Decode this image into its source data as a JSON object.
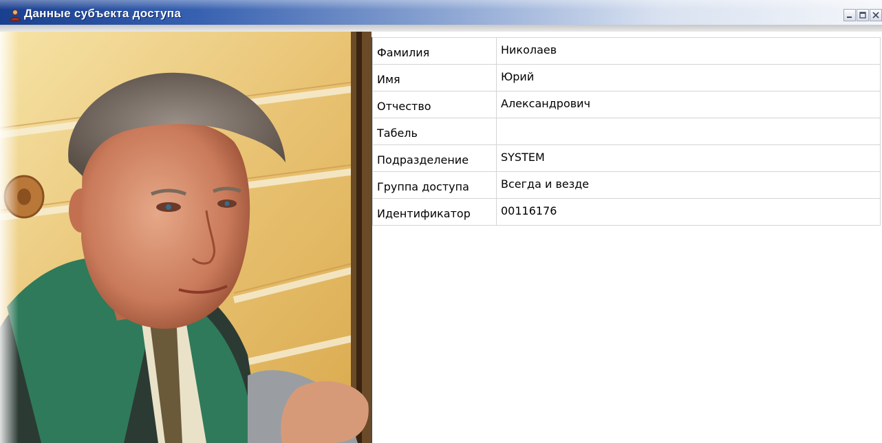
{
  "window": {
    "title": "Данные субъекта доступа",
    "controls": [
      "minimize-icon",
      "maximize-icon",
      "close-icon"
    ]
  },
  "photo": {
    "description_icon": "person-photo"
  },
  "properties": [
    {
      "key": "Фамилия",
      "value": "Николаев"
    },
    {
      "key": "Имя",
      "value": "Юрий"
    },
    {
      "key": "Отчество",
      "value": "Александрович"
    },
    {
      "key": "Табель",
      "value": ""
    },
    {
      "key": "Подразделение",
      "value": "SYSTEM"
    },
    {
      "key": "Группа доступа",
      "value": "Всегда и везде"
    },
    {
      "key": "Идентификатор",
      "value": "00116176"
    }
  ],
  "colors": {
    "titlebar_start": "#1a3f8f",
    "titlebar_end": "#f4f6fa",
    "grid_line": "#d4d4d4"
  }
}
